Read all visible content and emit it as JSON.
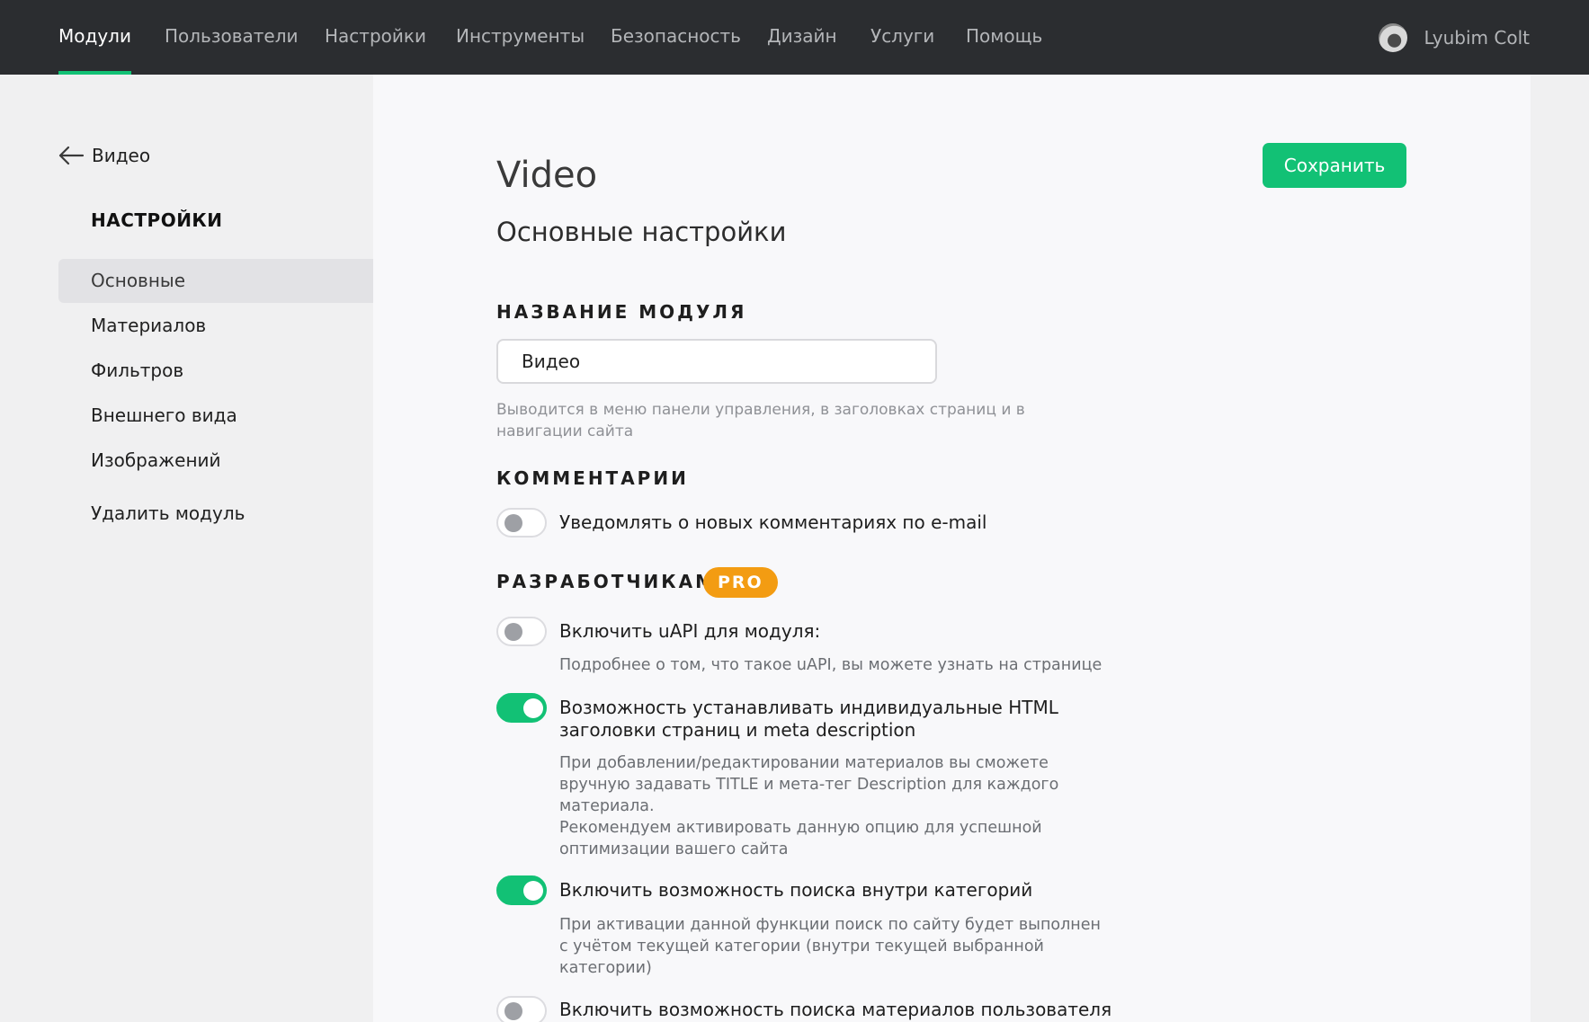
{
  "topnav": {
    "items": [
      "Модули",
      "Пользователи",
      "Настройки",
      "Инструменты",
      "Безопасность",
      "Дизайн",
      "Услуги",
      "Помощь"
    ],
    "active_index": 0,
    "user_name": "Lyubim Colt"
  },
  "sidebar": {
    "back_label": "Видео",
    "heading": "НАСТРОЙКИ",
    "items": [
      "Основные",
      "Материалов",
      "Фильтров",
      "Внешнего вида",
      "Изображений"
    ],
    "active_index": 0,
    "delete_label": "Удалить модуль"
  },
  "main": {
    "title": "Video",
    "section_title": "Основные настройки",
    "save_label": "Сохранить",
    "module_name": {
      "label": "НАЗВАНИЕ МОДУЛЯ",
      "value": "Видео",
      "hint_line1": "Выводится в меню панели управления, в заголовках страниц и в",
      "hint_line2": "навигации сайта"
    },
    "comments": {
      "label": "КОММЕНТАРИИ",
      "notify_label": "Уведомлять о новых комментариях по e-mail",
      "notify_on": false
    },
    "developers": {
      "label": "РАЗРАБОТЧИКАМ",
      "badge": "PRO",
      "options": [
        {
          "label_lines": [
            "Включить uAPI для модуля:"
          ],
          "desc_lines": [
            "Подробнее о том, что такое uAPI, вы можете узнать на странице"
          ],
          "on": false
        },
        {
          "label_lines": [
            "Возможность устанавливать индивидуальные HTML",
            "заголовки страниц и meta description"
          ],
          "desc_lines": [
            "При добавлении/редактировании материалов вы сможете",
            "вручную задавать TITLE и мета-тег Description для каждого",
            "материала.",
            "Рекомендуем активировать данную опцию для успешной",
            "оптимизации вашего сайта"
          ],
          "on": true
        },
        {
          "label_lines": [
            "Включить возможность поиска внутри категорий"
          ],
          "desc_lines": [
            "При активации данной функции поиск по сайту будет выполнен",
            "с учётом текущей категории (внутри текущей выбранной",
            "категории)"
          ],
          "on": true
        },
        {
          "label_lines": [
            "Включить возможность поиска материалов пользователя"
          ],
          "desc_lines": [],
          "on": false
        }
      ]
    }
  },
  "colors": {
    "accent": "#12c175",
    "topbar": "#2b2d30",
    "badge": "#f39c12"
  }
}
